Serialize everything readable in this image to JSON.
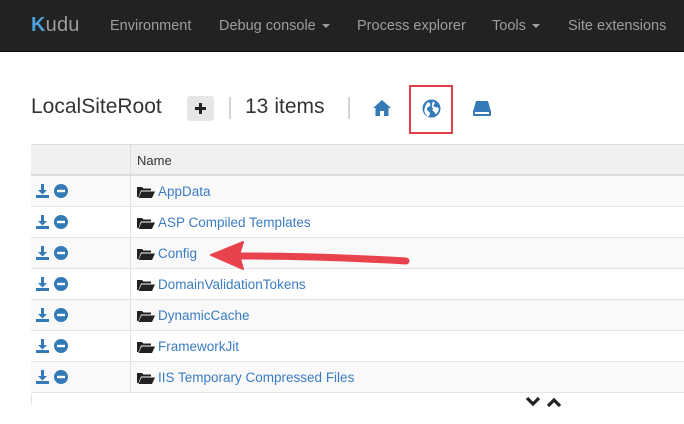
{
  "navbar": {
    "brand_prefix": "K",
    "brand_rest": "udu",
    "items": [
      {
        "label": "Environment",
        "dropdown": false
      },
      {
        "label": "Debug console",
        "dropdown": true
      },
      {
        "label": "Process explorer",
        "dropdown": false
      },
      {
        "label": "Tools",
        "dropdown": true
      },
      {
        "label": "Site extensions",
        "dropdown": false
      }
    ]
  },
  "header": {
    "title": "LocalSiteRoot",
    "item_count": "13",
    "item_count_label": "items",
    "icons": [
      "plus-icon",
      "home-icon",
      "globe-icon",
      "drive-icon"
    ]
  },
  "table": {
    "column_name": "Name",
    "rows": [
      {
        "name": "AppData"
      },
      {
        "name": "ASP Compiled Templates"
      },
      {
        "name": "Config"
      },
      {
        "name": "DomainValidationTokens"
      },
      {
        "name": "DynamicCache"
      },
      {
        "name": "FrameworkJit"
      },
      {
        "name": "IIS Temporary Compressed Files"
      }
    ]
  },
  "colors": {
    "navbar_bg": "#222222",
    "link": "#3a7cc2",
    "icon_blue": "#337ab7",
    "highlight_box": "#e0404a",
    "annotation_arrow": "#e8434d"
  }
}
